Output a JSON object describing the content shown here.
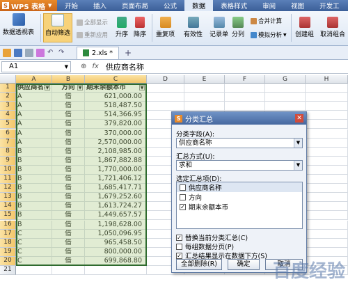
{
  "menubar": {
    "app": "WPS 表格",
    "items": [
      "开始",
      "插入",
      "页面布局",
      "公式",
      "数据",
      "表格样式",
      "审阅",
      "视图",
      "开发工"
    ],
    "active_index": 4
  },
  "ribbon": {
    "pivot": "数据透视表",
    "autofilter": "自动筛选",
    "show_all": "全部显示",
    "reapply": "重新应用",
    "sort_asc": "升序",
    "sort_desc": "降序",
    "duplicates": "重复项",
    "validity": "有效性",
    "record": "记录单",
    "split": "分列",
    "consolidate": "合并计算",
    "simulate": "模拟分析",
    "create_group": "创建组",
    "ungroup": "取消组合"
  },
  "toolbar": {
    "tab_name": "2.xls *"
  },
  "formula_bar": {
    "cell_ref": "A1",
    "fx": "fx",
    "value": "供应商名称"
  },
  "sheet": {
    "columns": [
      "A",
      "B",
      "C",
      "D",
      "E",
      "F",
      "G",
      "H"
    ],
    "headers": [
      "供应商名称",
      "方向",
      "期末余额本币"
    ],
    "rows": [
      [
        "A",
        "借",
        "621,000.00"
      ],
      [
        "A",
        "借",
        "518,487.50"
      ],
      [
        "A",
        "借",
        "514,366.95"
      ],
      [
        "A",
        "借",
        "379,820.00"
      ],
      [
        "A",
        "借",
        "370,000.00"
      ],
      [
        "A",
        "借",
        "2,570,000.00"
      ],
      [
        "B",
        "借",
        "2,108,985.00"
      ],
      [
        "B",
        "借",
        "1,867,882.88"
      ],
      [
        "B",
        "借",
        "1,770,000.00"
      ],
      [
        "B",
        "借",
        "1,721,406.12"
      ],
      [
        "B",
        "借",
        "1,685,417.71"
      ],
      [
        "B",
        "借",
        "1,679,252.60"
      ],
      [
        "B",
        "借",
        "1,613,724.27"
      ],
      [
        "B",
        "借",
        "1,449,657.57"
      ],
      [
        "B",
        "借",
        "1,198,628.00"
      ],
      [
        "C",
        "借",
        "1,050,096.95"
      ],
      [
        "C",
        "借",
        "965,458.50"
      ],
      [
        "C",
        "借",
        "800,000.00"
      ],
      [
        "C",
        "借",
        "699,868.80"
      ]
    ],
    "row_numbers": [
      "1",
      "2",
      "3",
      "4",
      "5",
      "6",
      "7",
      "8",
      "9",
      "10",
      "11",
      "12",
      "13",
      "14",
      "15",
      "16",
      "17",
      "18",
      "19",
      "20",
      "21"
    ]
  },
  "dialog": {
    "title": "分类汇总",
    "group_label": "分类字段(A):",
    "group_value": "供应商名称",
    "func_label": "汇总方式(U):",
    "func_value": "求和",
    "items_label": "选定汇总项(D):",
    "items": [
      {
        "label": "供应商名称",
        "checked": false
      },
      {
        "label": "方向",
        "checked": false
      },
      {
        "label": "期末余额本币",
        "checked": true
      }
    ],
    "options": [
      {
        "label": "替换当前分类汇总(C)",
        "checked": true
      },
      {
        "label": "每组数据分页(P)",
        "checked": false
      },
      {
        "label": "汇总结果显示在数据下方(S)",
        "checked": true
      }
    ],
    "btn_remove": "全部删除(R)",
    "btn_ok": "确定",
    "btn_cancel": "取消"
  },
  "watermark": "百度经验"
}
